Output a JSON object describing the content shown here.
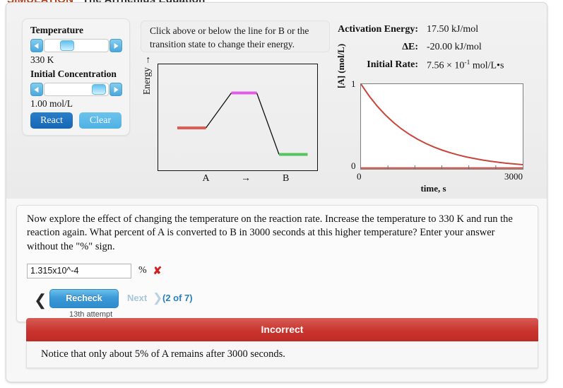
{
  "header": {
    "sim_tag": "SIMULATION",
    "title": "The Arrhenius Equation"
  },
  "controls": {
    "temperature_label": "Temperature",
    "temperature_value": "330 K",
    "temperature_thumb_pct": 36,
    "concentration_label": "Initial Concentration",
    "concentration_value": "1.00 mol/L",
    "concentration_thumb_pct": 86,
    "react_label": "React",
    "clear_label": "Clear"
  },
  "hint": {
    "text": "Click above or below the line for B or the transition state to change their energy."
  },
  "readouts": [
    {
      "key": "Activation Energy:",
      "value": "17.50 kJ/mol"
    },
    {
      "key": "ΔE:",
      "value": "-20.00 kJ/mol"
    },
    {
      "key": "Initial Rate:",
      "value_mantissa": "7.56 × 10",
      "value_exp": "-1",
      "value_unit": " mol/L•s"
    }
  ],
  "chart_data": [
    {
      "type": "line",
      "name": "energy-profile",
      "title": "",
      "xlabel": "",
      "ylabel": "Energy →",
      "grid": false,
      "x_tick_labels": [
        "A",
        "→",
        "B"
      ],
      "levels": [
        {
          "name": "reactant A",
          "color": "#e05c52",
          "x_start_pct": 12,
          "x_end_pct": 30,
          "y_pct": 60
        },
        {
          "name": "transition state",
          "color": "#e05ce6",
          "x_start_pct": 46,
          "x_end_pct": 62,
          "y_pct": 27
        },
        {
          "name": "product B",
          "color": "#55c45f",
          "x_start_pct": 76,
          "x_end_pct": 94,
          "y_pct": 85
        }
      ]
    },
    {
      "type": "line",
      "name": "concentration-vs-time",
      "title": "",
      "xlabel": "time, s",
      "ylabel": "[A] (mol/L)",
      "grid": false,
      "xlim": [
        0,
        3000
      ],
      "ylim": [
        0,
        1
      ],
      "x_tick_labels": [
        "0",
        "3000"
      ],
      "y_tick_labels": [
        "0",
        "1"
      ],
      "series": [
        {
          "name": "[A]",
          "color": "#c8453c",
          "x": [
            0,
            150,
            300,
            450,
            600,
            750,
            900,
            1050,
            1200,
            1350,
            1500,
            1650,
            1800,
            1950,
            2100,
            2250,
            2400,
            2550,
            2700,
            2850,
            3000
          ],
          "y": [
            1.0,
            0.861,
            0.741,
            0.638,
            0.549,
            0.472,
            0.407,
            0.35,
            0.301,
            0.259,
            0.223,
            0.192,
            0.165,
            0.142,
            0.123,
            0.105,
            0.091,
            0.078,
            0.067,
            0.058,
            0.05
          ]
        }
      ]
    }
  ],
  "question": {
    "text": "Now explore the effect of changing the temperature on the reaction rate. Increase the temperature to 330 K and run the reaction again. What percent of A is converted to B in 3000 seconds at this higher temperature? Enter your answer without the \"%\" sign.",
    "answer_value": "1.315x10^-4",
    "answer_placeholder": "",
    "unit_suffix": "%",
    "result_mark": "✘"
  },
  "nav": {
    "prev_icon": "❮",
    "recheck_label": "Recheck",
    "next_label": "Next",
    "next_icon": "❯",
    "counter": "(2 of 7)",
    "attempt": "13th attempt"
  },
  "feedback": {
    "status": "Incorrect",
    "message": "Notice that only about 5% of A remains after 3000 seconds.",
    "status_color": "#c9342e"
  }
}
